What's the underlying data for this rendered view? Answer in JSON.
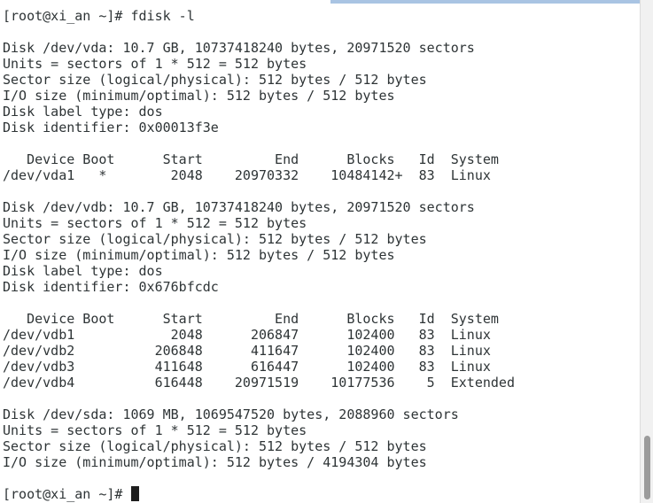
{
  "terminal": {
    "lines": [
      "[root@xi_an ~]# fdisk -l",
      "",
      "Disk /dev/vda: 10.7 GB, 10737418240 bytes, 20971520 sectors",
      "Units = sectors of 1 * 512 = 512 bytes",
      "Sector size (logical/physical): 512 bytes / 512 bytes",
      "I/O size (minimum/optimal): 512 bytes / 512 bytes",
      "Disk label type: dos",
      "Disk identifier: 0x00013f3e",
      "",
      "   Device Boot      Start         End      Blocks   Id  System",
      "/dev/vda1   *        2048    20970332    10484142+  83  Linux",
      "",
      "Disk /dev/vdb: 10.7 GB, 10737418240 bytes, 20971520 sectors",
      "Units = sectors of 1 * 512 = 512 bytes",
      "Sector size (logical/physical): 512 bytes / 512 bytes",
      "I/O size (minimum/optimal): 512 bytes / 512 bytes",
      "Disk label type: dos",
      "Disk identifier: 0x676bfcdc",
      "",
      "   Device Boot      Start         End      Blocks   Id  System",
      "/dev/vdb1            2048      206847      102400   83  Linux",
      "/dev/vdb2          206848      411647      102400   83  Linux",
      "/dev/vdb3          411648      616447      102400   83  Linux",
      "/dev/vdb4          616448    20971519    10177536    5  Extended",
      "",
      "Disk /dev/sda: 1069 MB, 1069547520 bytes, 2088960 sectors",
      "Units = sectors of 1 * 512 = 512 bytes",
      "Sector size (logical/physical): 512 bytes / 512 bytes",
      "I/O size (minimum/optimal): 512 bytes / 4194304 bytes",
      "",
      "[root@xi_an ~]# "
    ]
  },
  "colors": {
    "text": "#2e3436",
    "background": "#ffffff",
    "cursor": "#1e1e1e"
  }
}
